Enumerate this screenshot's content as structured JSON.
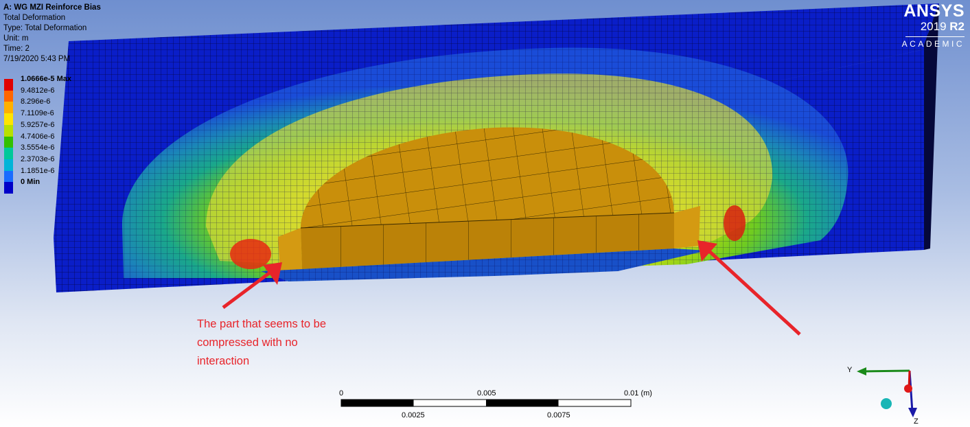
{
  "header": {
    "title": "A: WG MZI Reinforce Bias",
    "lines": [
      "Total Deformation",
      "Type: Total Deformation",
      "Unit: m",
      "Time: 2",
      "7/19/2020 5:43 PM"
    ]
  },
  "legend": [
    {
      "label": "1.0666e-5 Max",
      "color": "#e00000",
      "bold": true
    },
    {
      "label": "9.4812e-6",
      "color": "#ff6600"
    },
    {
      "label": "8.296e-6",
      "color": "#ffb000"
    },
    {
      "label": "7.1109e-6",
      "color": "#ffe400"
    },
    {
      "label": "5.9257e-6",
      "color": "#b8e000"
    },
    {
      "label": "4.7406e-6",
      "color": "#33c000"
    },
    {
      "label": "3.5554e-6",
      "color": "#00c89a"
    },
    {
      "label": "2.3703e-6",
      "color": "#00b4d8"
    },
    {
      "label": "1.1851e-6",
      "color": "#1a6cff"
    },
    {
      "label": "0 Min",
      "color": "#0000c8",
      "bold": true
    }
  ],
  "branding": {
    "name": "ANSYS",
    "version_year": "2019",
    "version_release": "R2",
    "edition": "ACADEMIC"
  },
  "annotation": {
    "text": "The part that seems to be compressed with no interaction",
    "color": "#e8242a"
  },
  "scale_bar": {
    "top_labels": [
      "0",
      "0.005",
      "0.01 (m)"
    ],
    "bottom_labels": [
      "0.0025",
      "0.0075"
    ]
  },
  "triad": {
    "axes": [
      "Y",
      "Z"
    ]
  }
}
